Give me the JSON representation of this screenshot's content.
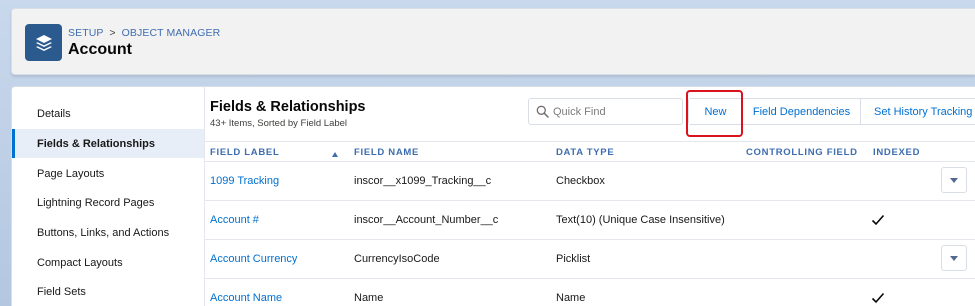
{
  "header": {
    "breadcrumb": [
      "SETUP",
      "OBJECT MANAGER"
    ],
    "breadcrumb_separator": ">",
    "title": "Account",
    "icon": "layers-icon"
  },
  "sidebar": {
    "items": [
      {
        "label": "Details",
        "active": false
      },
      {
        "label": "Fields & Relationships",
        "active": true
      },
      {
        "label": "Page Layouts",
        "active": false
      },
      {
        "label": "Lightning Record Pages",
        "active": false
      },
      {
        "label": "Buttons, Links, and Actions",
        "active": false
      },
      {
        "label": "Compact Layouts",
        "active": false
      },
      {
        "label": "Field Sets",
        "active": false
      }
    ]
  },
  "main": {
    "title": "Fields & Relationships",
    "subtitle": "43+ Items, Sorted by Field Label",
    "search": {
      "placeholder": "Quick Find",
      "value": ""
    },
    "buttons": {
      "new": "New",
      "field_dependencies": "Field Dependencies",
      "set_history_tracking": "Set History Tracking"
    },
    "table": {
      "columns": [
        "FIELD LABEL",
        "FIELD NAME",
        "DATA TYPE",
        "CONTROLLING FIELD",
        "INDEXED"
      ],
      "sort_column": "FIELD LABEL",
      "sort_direction": "ascending",
      "rows": [
        {
          "label": "1099 Tracking",
          "name": "inscor__x1099_Tracking__c",
          "type": "Checkbox",
          "controlling": "",
          "indexed": false
        },
        {
          "label": "Account #",
          "name": "inscor__Account_Number__c",
          "type": "Text(10) (Unique Case Insensitive)",
          "controlling": "",
          "indexed": true
        },
        {
          "label": "Account Currency",
          "name": "CurrencyIsoCode",
          "type": "Picklist",
          "controlling": "",
          "indexed": false
        },
        {
          "label": "Account Name",
          "name": "Name",
          "type": "Name",
          "controlling": "",
          "indexed": true
        }
      ]
    }
  },
  "colors": {
    "accent": "#0070d2",
    "highlight": "#d9121c",
    "icon_bg": "#2a5a8e"
  }
}
